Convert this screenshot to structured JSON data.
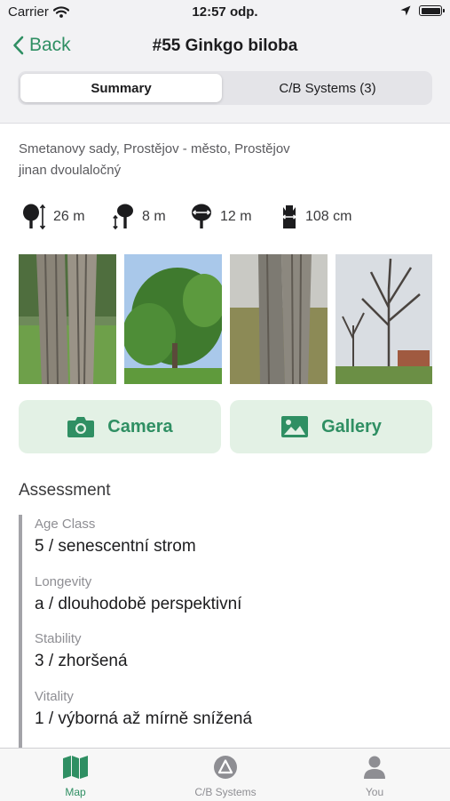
{
  "status_bar": {
    "carrier": "Carrier",
    "time": "12:57 odp."
  },
  "nav": {
    "back_label": "Back",
    "title": "#55 Ginkgo biloba"
  },
  "segments": {
    "summary": "Summary",
    "systems": "C/B Systems (3)",
    "selected": "Summary"
  },
  "location": {
    "address": "Smetanovy sady, Prostějov - město, Prostějov",
    "common_name": "jinan dvoulaločný"
  },
  "metrics": [
    {
      "icon": "tree-height-icon",
      "value": "26 m"
    },
    {
      "icon": "crown-base-height-icon",
      "value": "8 m"
    },
    {
      "icon": "crown-width-icon",
      "value": "12 m"
    },
    {
      "icon": "trunk-circumference-icon",
      "value": "108 cm"
    }
  ],
  "photos": [
    {
      "name": "tree-photo-1"
    },
    {
      "name": "tree-photo-2"
    },
    {
      "name": "tree-photo-3"
    },
    {
      "name": "tree-photo-4"
    }
  ],
  "actions": {
    "camera_label": "Camera",
    "gallery_label": "Gallery"
  },
  "assessment": {
    "title": "Assessment",
    "items": [
      {
        "label": "Age Class",
        "value": "5 / senescentní strom"
      },
      {
        "label": "Longevity",
        "value": "a / dlouhodobě perspektivní"
      },
      {
        "label": "Stability",
        "value": "3 / zhoršená"
      },
      {
        "label": "Vitality",
        "value": "1 / výborná až mírně snížená"
      }
    ]
  },
  "tabs": [
    {
      "label": "Map",
      "icon": "map-icon",
      "active": true
    },
    {
      "label": "C/B Systems",
      "icon": "triangle-icon",
      "active": false
    },
    {
      "label": "You",
      "icon": "person-icon",
      "active": false
    }
  ],
  "colors": {
    "accent": "#2f8f63",
    "button_bg": "#e3f1e5",
    "inactive": "#8e8e93",
    "background": "#f2f2f4"
  }
}
